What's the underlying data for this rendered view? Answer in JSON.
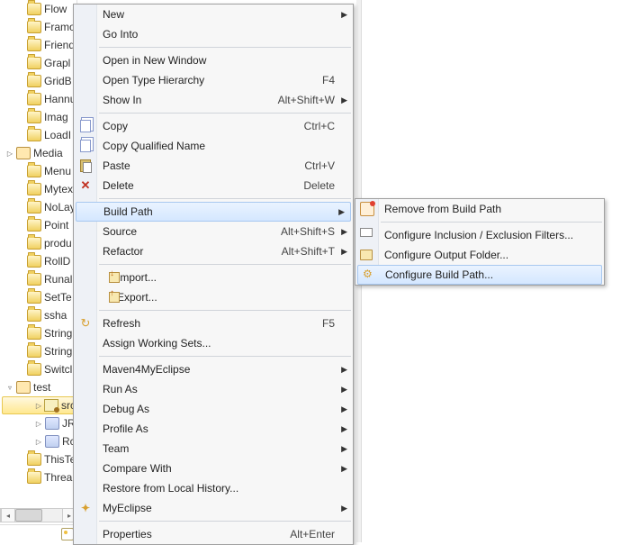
{
  "tree": {
    "items": [
      {
        "label": "Flow",
        "indent": 1,
        "type": "folder"
      },
      {
        "label": "Framo",
        "indent": 1,
        "type": "folder"
      },
      {
        "label": "Friend",
        "indent": 1,
        "type": "folder"
      },
      {
        "label": "Grapl",
        "indent": 1,
        "type": "folder"
      },
      {
        "label": "GridB",
        "indent": 1,
        "type": "folder"
      },
      {
        "label": "Hannu",
        "indent": 1,
        "type": "folder"
      },
      {
        "label": "Imag",
        "indent": 1,
        "type": "folder"
      },
      {
        "label": "LoadI",
        "indent": 1,
        "type": "folder"
      },
      {
        "label": "Media",
        "indent": 0,
        "type": "proj",
        "arrow": "▷"
      },
      {
        "label": "Menu",
        "indent": 1,
        "type": "folder"
      },
      {
        "label": "Mytex",
        "indent": 1,
        "type": "folder"
      },
      {
        "label": "NoLay",
        "indent": 1,
        "type": "folder"
      },
      {
        "label": "Point",
        "indent": 1,
        "type": "folder"
      },
      {
        "label": "produ",
        "indent": 1,
        "type": "folder"
      },
      {
        "label": "RollD",
        "indent": 1,
        "type": "folder"
      },
      {
        "label": "Runal",
        "indent": 1,
        "type": "folder"
      },
      {
        "label": "SetTe",
        "indent": 1,
        "type": "folder"
      },
      {
        "label": "ssha",
        "indent": 1,
        "type": "folder"
      },
      {
        "label": "String",
        "indent": 1,
        "type": "folder"
      },
      {
        "label": "String",
        "indent": 1,
        "type": "folder"
      },
      {
        "label": "Switcl",
        "indent": 1,
        "type": "folder"
      },
      {
        "label": "test",
        "indent": 0,
        "type": "proj",
        "arrow": "▿"
      },
      {
        "label": "src",
        "indent": 2,
        "type": "src",
        "arrow": "▷",
        "selected": true
      },
      {
        "label": "JR",
        "indent": 2,
        "type": "jar",
        "arrow": "▷"
      },
      {
        "label": "Rc",
        "indent": 2,
        "type": "jar",
        "arrow": "▷"
      },
      {
        "label": "ThisTe",
        "indent": 1,
        "type": "folder"
      },
      {
        "label": "Threa",
        "indent": 1,
        "type": "folder"
      }
    ]
  },
  "menu1": [
    {
      "kind": "item",
      "label": "New",
      "arrow": true
    },
    {
      "kind": "item",
      "label": "Go Into"
    },
    {
      "kind": "sep"
    },
    {
      "kind": "item",
      "label": "Open in New Window"
    },
    {
      "kind": "item",
      "label": "Open Type Hierarchy",
      "shortcut": "F4"
    },
    {
      "kind": "item",
      "label": "Show In",
      "shortcut": "Alt+Shift+W",
      "arrow": true
    },
    {
      "kind": "sep"
    },
    {
      "kind": "item",
      "label": "Copy",
      "shortcut": "Ctrl+C",
      "icon": "copy"
    },
    {
      "kind": "item",
      "label": "Copy Qualified Name",
      "icon": "copy"
    },
    {
      "kind": "item",
      "label": "Paste",
      "shortcut": "Ctrl+V",
      "icon": "paste"
    },
    {
      "kind": "item",
      "label": "Delete",
      "shortcut": "Delete",
      "icon": "delete"
    },
    {
      "kind": "sep"
    },
    {
      "kind": "item",
      "label": "Build Path",
      "arrow": true,
      "hover": true
    },
    {
      "kind": "item",
      "label": "Source",
      "shortcut": "Alt+Shift+S",
      "arrow": true
    },
    {
      "kind": "item",
      "label": "Refactor",
      "shortcut": "Alt+Shift+T",
      "arrow": true
    },
    {
      "kind": "sep"
    },
    {
      "kind": "item",
      "label": "Import...",
      "icon": "import"
    },
    {
      "kind": "item",
      "label": "Export...",
      "icon": "export"
    },
    {
      "kind": "sep"
    },
    {
      "kind": "item",
      "label": "Refresh",
      "shortcut": "F5",
      "icon": "refresh"
    },
    {
      "kind": "item",
      "label": "Assign Working Sets..."
    },
    {
      "kind": "sep"
    },
    {
      "kind": "item",
      "label": "Maven4MyEclipse",
      "arrow": true
    },
    {
      "kind": "item",
      "label": "Run As",
      "arrow": true
    },
    {
      "kind": "item",
      "label": "Debug As",
      "arrow": true
    },
    {
      "kind": "item",
      "label": "Profile As",
      "arrow": true
    },
    {
      "kind": "item",
      "label": "Team",
      "arrow": true
    },
    {
      "kind": "item",
      "label": "Compare With",
      "arrow": true
    },
    {
      "kind": "item",
      "label": "Restore from Local History..."
    },
    {
      "kind": "item",
      "label": "MyEclipse",
      "arrow": true,
      "icon": "my"
    },
    {
      "kind": "sep"
    },
    {
      "kind": "item",
      "label": "Properties",
      "shortcut": "Alt+Enter"
    }
  ],
  "menu2": [
    {
      "label": "Remove from Build Path",
      "icon": "remove"
    },
    {
      "sep": true
    },
    {
      "label": "Configure Inclusion / Exclusion Filters...",
      "icon": "filter"
    },
    {
      "label": "Configure Output Folder...",
      "icon": "output"
    },
    {
      "label": "Configure Build Path...",
      "icon": "build",
      "hover": true
    }
  ]
}
